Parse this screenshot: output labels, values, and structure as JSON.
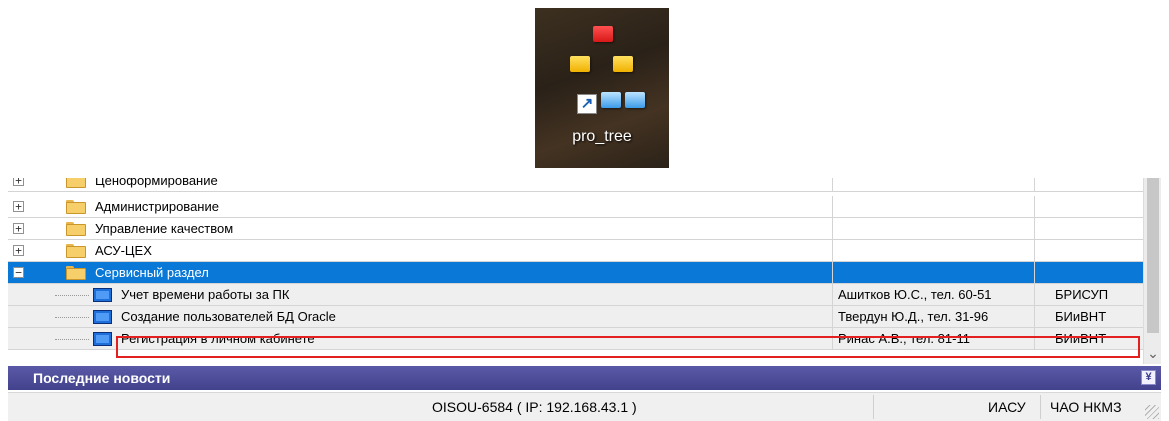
{
  "desktop_shortcut": {
    "label": "pro_tree",
    "shortcut_arrow": "↗",
    "icon": "tree-app-icon"
  },
  "tree": {
    "rows": [
      {
        "name": "Ценоформирование",
        "contact": "",
        "dept": "",
        "type": "folder",
        "expander": "+"
      },
      {
        "name": "Администрирование",
        "contact": "",
        "dept": "",
        "type": "folder",
        "expander": "+"
      },
      {
        "name": "Управление качеством",
        "contact": "",
        "dept": "",
        "type": "folder",
        "expander": "+"
      },
      {
        "name": "АСУ-ЦЕХ",
        "contact": "",
        "dept": "",
        "type": "folder",
        "expander": "+"
      },
      {
        "name": "Сервисный раздел",
        "contact": "",
        "dept": "",
        "type": "folder",
        "expander": "−",
        "selected": true
      },
      {
        "name": "Учет времени работы за ПК",
        "contact": "Ашитков Ю.С., тел. 60-51",
        "dept": "БРИСУП",
        "type": "app"
      },
      {
        "name": "Создание пользователей БД Oracle",
        "contact": "Твердун Ю.Д., тел. 31-96",
        "dept": "БИиВНТ",
        "type": "app"
      },
      {
        "name": "Регистрация в личном кабинете",
        "contact": "Ринас А.В., тел. 81-11",
        "dept": "БИиВНТ",
        "type": "app",
        "highlighted": true
      }
    ]
  },
  "scrollbar": {
    "arrow": "⌄"
  },
  "news": {
    "title": "Последние новости",
    "collapse_glyph": "¥"
  },
  "status": {
    "host": "OISOU-6584 ( IP: 192.168.43.1 )",
    "system": "ИАСУ",
    "org": "ЧАО НКМЗ"
  },
  "colors": {
    "selection": "#0a78d7",
    "news_bar": "#4b4b97",
    "highlight_border": "#e32020"
  }
}
